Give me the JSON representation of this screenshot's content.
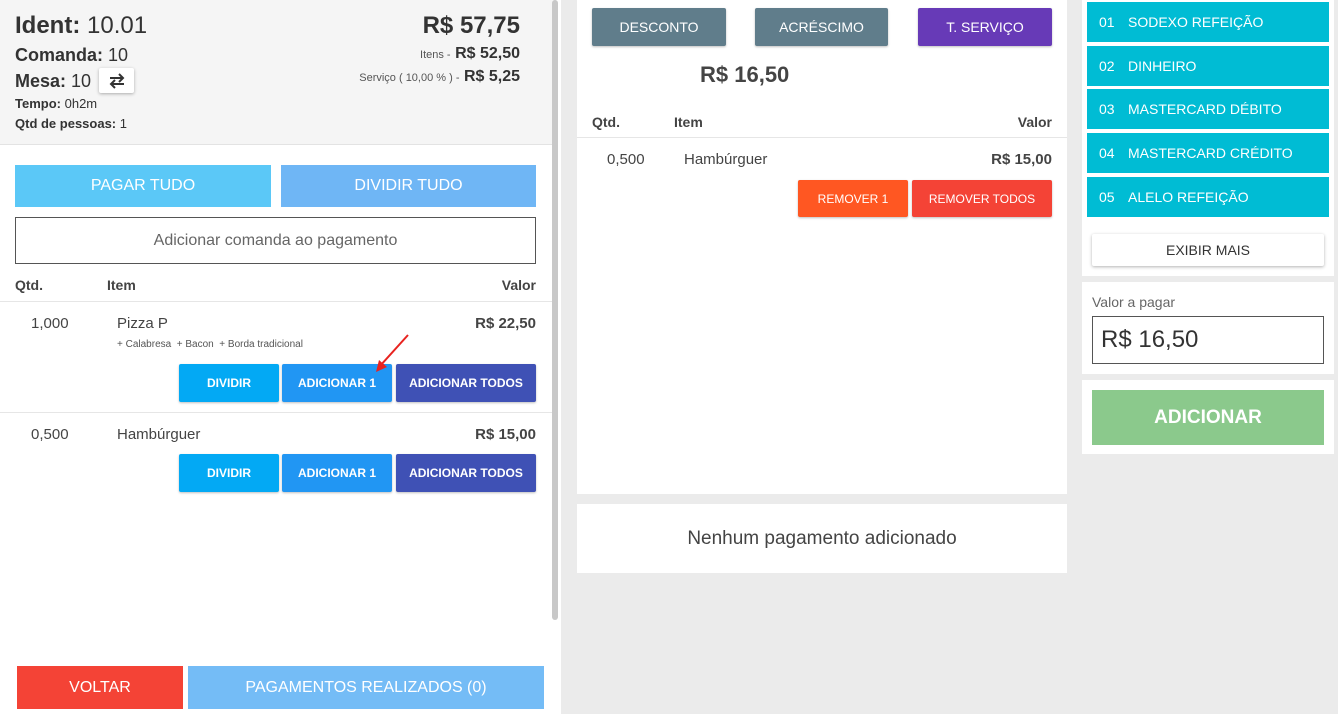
{
  "summary": {
    "ident_label": "Ident:",
    "ident_value": "10.01",
    "comanda_label": "Comanda:",
    "comanda_value": "10",
    "mesa_label": "Mesa:",
    "mesa_value": "10",
    "tempo_label": "Tempo:",
    "tempo_value": "0h2m",
    "pessoas_label": "Qtd de pessoas:",
    "pessoas_value": "1",
    "total": "R$ 57,75",
    "itens_label": "Itens -",
    "itens_value": "R$ 52,50",
    "servico_label": "Serviço ( 10,00 % ) -",
    "servico_value": "R$ 5,25",
    "transfer_icon": "swap-arrows-icon"
  },
  "actions": {
    "pagar_tudo": "PAGAR TUDO",
    "dividir_tudo": "DIVIDIR TUDO",
    "add_comanda_placeholder": "Adicionar comanda ao pagamento"
  },
  "left_table": {
    "headers": {
      "qtd": "Qtd.",
      "item": "Item",
      "valor": "Valor"
    },
    "rows": [
      {
        "qtd": "1,000",
        "item": "Pizza P",
        "extras": "+ Calabresa  + Bacon  + Borda tradicional",
        "valor": "R$ 22,50",
        "btn_dividir": "DIVIDIR",
        "btn_add1": "ADICIONAR 1",
        "btn_addall": "ADICIONAR TODOS"
      },
      {
        "qtd": "0,500",
        "item": "Hambúrguer",
        "valor": "R$ 15,00",
        "btn_dividir": "DIVIDIR",
        "btn_add1": "ADICIONAR 1",
        "btn_addall": "ADICIONAR TODOS"
      }
    ]
  },
  "footer": {
    "voltar": "VOLTAR",
    "pagamentos": "PAGAMENTOS REALIZADOS (0)"
  },
  "middle": {
    "desconto": "DESCONTO",
    "acrescimo": "ACRÉSCIMO",
    "servico": "T. SERVIÇO",
    "subtotal": "R$ 16,50",
    "headers": {
      "qtd": "Qtd.",
      "item": "Item",
      "valor": "Valor"
    },
    "rows": [
      {
        "qtd": "0,500",
        "item": "Hambúrguer",
        "valor": "R$ 15,00",
        "btn_rem1": "REMOVER 1",
        "btn_remall": "REMOVER TODOS"
      }
    ],
    "empty_payments": "Nenhum pagamento adicionado"
  },
  "payment_methods": [
    {
      "num": "01",
      "name": "SODEXO REFEIÇÃO"
    },
    {
      "num": "02",
      "name": "DINHEIRO"
    },
    {
      "num": "03",
      "name": "MASTERCARD DÉBITO"
    },
    {
      "num": "04",
      "name": "MASTERCARD CRÉDITO"
    },
    {
      "num": "05",
      "name": "ALELO REFEIÇÃO"
    }
  ],
  "exibir_mais": "EXIBIR MAIS",
  "valor_a_pagar": {
    "label": "Valor a pagar",
    "value": "R$ 16,50"
  },
  "adicionar": "ADICIONAR",
  "colors": {
    "cyan": "#00bcd4",
    "blue_light": "#4fc3f7",
    "blue": "#039be5",
    "indigo": "#3f51b5",
    "red": "#f44336",
    "orange": "#ff5722",
    "purple": "#673ab7",
    "slate": "#607d8b",
    "green_disabled": "#8bc98c"
  }
}
